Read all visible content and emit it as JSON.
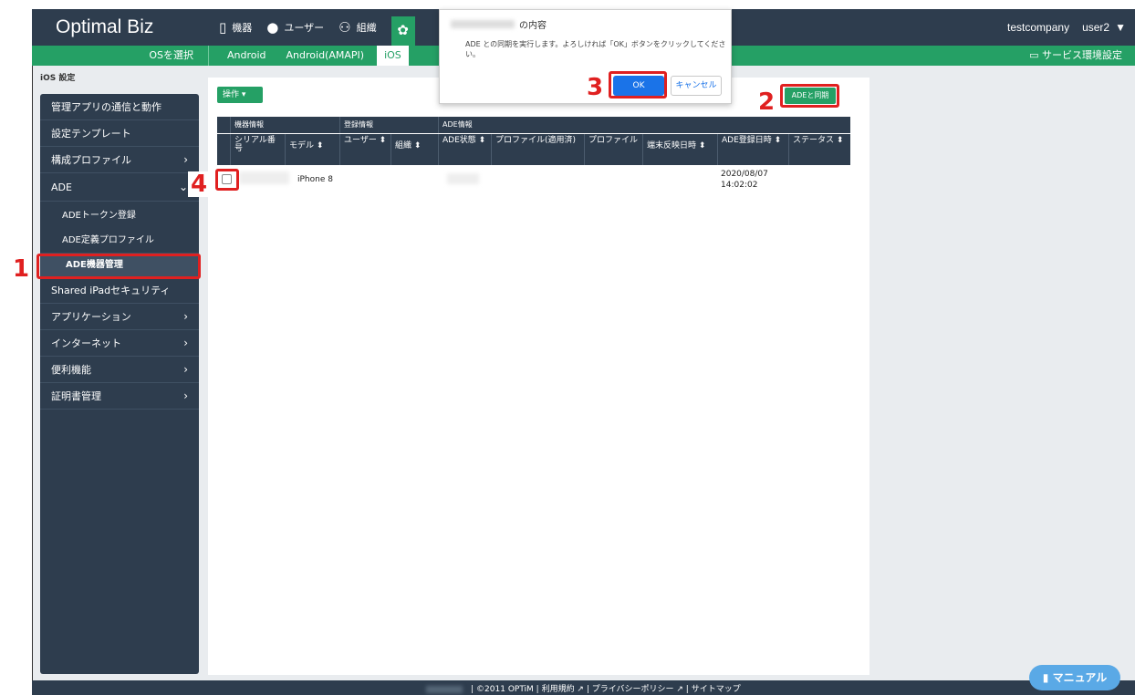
{
  "header": {
    "brand": "Optimal Biz",
    "nav": [
      {
        "icon": "device-icon",
        "label": "機器"
      },
      {
        "icon": "user-icon",
        "label": "ユーザー"
      },
      {
        "icon": "group-icon",
        "label": "組織"
      }
    ],
    "company": "testcompany",
    "user": "user2"
  },
  "subbar": {
    "os_select": "OSを選択",
    "tabs": [
      "Android",
      "Android(AMAPI)",
      "iOS"
    ],
    "service_setting": "サービス環境設定"
  },
  "sidebar": {
    "section_title": "iOS 設定",
    "items": [
      {
        "label": "管理アプリの通信と動作"
      },
      {
        "label": "設定テンプレート"
      },
      {
        "label": "構成プロファイル"
      },
      {
        "label": "ADE"
      },
      {
        "label": "ADEトークン登録"
      },
      {
        "label": "ADE定義プロファイル"
      },
      {
        "label": "ADE機器管理"
      },
      {
        "label": "Shared iPadセキュリティ"
      },
      {
        "label": "アプリケーション"
      },
      {
        "label": "インターネット"
      },
      {
        "label": "便利機能"
      },
      {
        "label": "証明書管理"
      }
    ]
  },
  "toolbar": {
    "operation": "操作 ▾",
    "sync": "ADEと同期"
  },
  "table": {
    "groups": [
      "機器情報",
      "登録情報",
      "ADE情報"
    ],
    "columns": [
      "シリアル番号",
      "モデル ⬍",
      "ユーザー ⬍",
      "組織 ⬍",
      "ADE状態 ⬍",
      "プロファイル(適用済)",
      "プロファイル",
      "端末反映日時 ⬍",
      "ADE登録日時 ⬍",
      "ステータス ⬍"
    ],
    "rows": [
      {
        "model": "iPhone 8",
        "registered_date": "2020/08/07",
        "registered_time": "14:02:02"
      }
    ]
  },
  "dialog": {
    "title": "の内容",
    "message": "ADE との同期を実行します。よろしければ「OK」ボタンをクリックしてください。",
    "ok": "OK",
    "cancel": "キャンセル"
  },
  "annotations": [
    "1",
    "2",
    "3",
    "4"
  ],
  "footer": {
    "text": "| ©2011 OPTiM | 利用規約 ↗ | プライバシーポリシー ↗ | サイトマップ"
  },
  "manual_button": "マニュアル",
  "colors": {
    "navy": "#2e3d4e",
    "green": "#25a065",
    "annotation_red": "#e02020",
    "ok_blue": "#1a73e8"
  }
}
